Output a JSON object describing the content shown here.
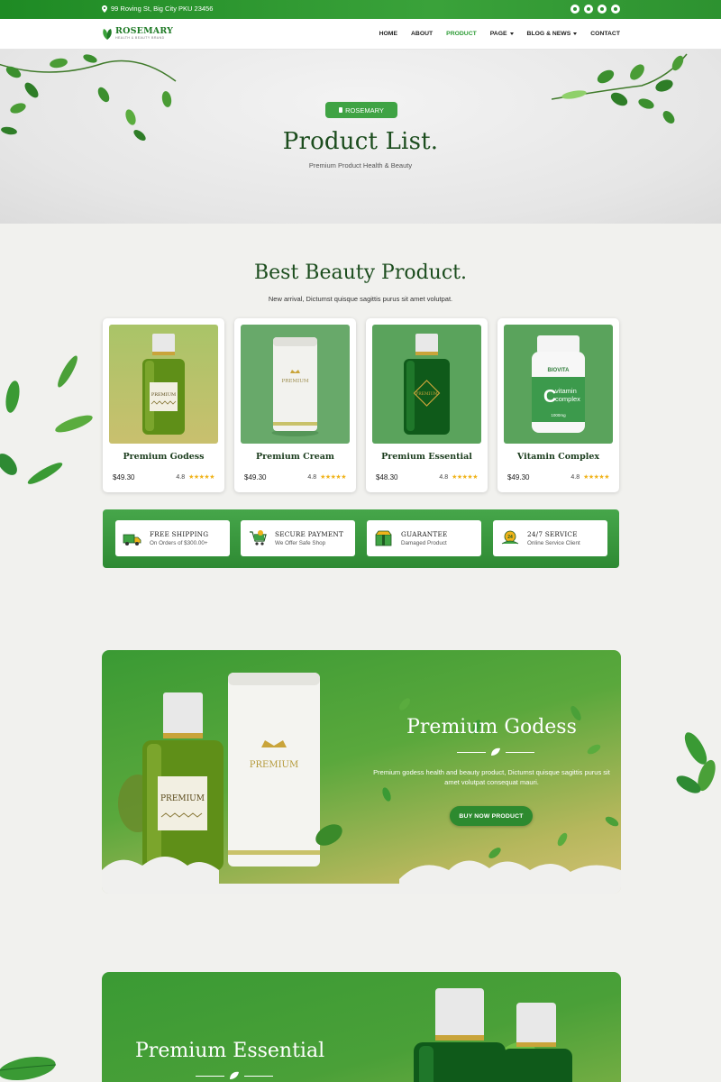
{
  "topbar": {
    "address": "99 Roving St, Big City PKU 23456",
    "social": [
      "facebook-icon",
      "twitter-icon",
      "instagram-icon",
      "youtube-icon"
    ]
  },
  "logo": {
    "name": "ROSEMARY",
    "tagline": "HEALTH & BEAUTY BRAND"
  },
  "nav": {
    "items": [
      {
        "label": "HOME"
      },
      {
        "label": "ABOUT"
      },
      {
        "label": "PRODUCT"
      },
      {
        "label": "PAGE"
      },
      {
        "label": "BLOG & NEWS"
      },
      {
        "label": "CONTACT"
      }
    ],
    "active": "PRODUCT"
  },
  "hero": {
    "badge": "ROSEMARY",
    "title": "Product List.",
    "subtitle": "Premium Product Health & Beauty"
  },
  "section": {
    "title": "Best Beauty Product.",
    "subtitle": "New arrival, Dictumst quisque sagittis purus sit amet volutpat."
  },
  "products": [
    {
      "name": "Premium Godess",
      "price": "$49.30",
      "rating": "4.8",
      "stars": 5
    },
    {
      "name": "Premium Cream",
      "price": "$49.30",
      "rating": "4.8",
      "stars": 5
    },
    {
      "name": "Premium Essential",
      "price": "$48.30",
      "rating": "4.8",
      "stars": 5
    },
    {
      "name": "Vitamin Complex",
      "price": "$49.30",
      "rating": "4.8",
      "stars": 5
    }
  ],
  "features": [
    {
      "title": "FREE SHIPPING",
      "desc": "On Orders of $300.00+",
      "icon": "truck-icon"
    },
    {
      "title": "SECURE PAYMENT",
      "desc": "We Offer Safe Shop",
      "icon": "cart-icon"
    },
    {
      "title": "GUARANTEE",
      "desc": "Damaged Product",
      "icon": "box-icon"
    },
    {
      "title": "24/7 SERVICE",
      "desc": "Online Service Client",
      "icon": "support-icon"
    }
  ],
  "promo1": {
    "title": "Premium Godess",
    "desc": "Premium godess health and beauty product, Dictumst quisque sagittis purus sit amet volutpat consequat mauri.",
    "button": "BUY NOW PRODUCT",
    "bottle_label": "PREMIUM",
    "box_label": "PREMIUM"
  },
  "promo2": {
    "title": "Premium Essential"
  },
  "vitamin": {
    "brand": "BIOVITA",
    "label1": "vitamin",
    "label2": "complex",
    "dose": "1000mg",
    "letter": "C"
  },
  "colors": {
    "primary": "#2b9a33",
    "dark_green": "#1c4d1e",
    "star": "#f0b31a"
  }
}
